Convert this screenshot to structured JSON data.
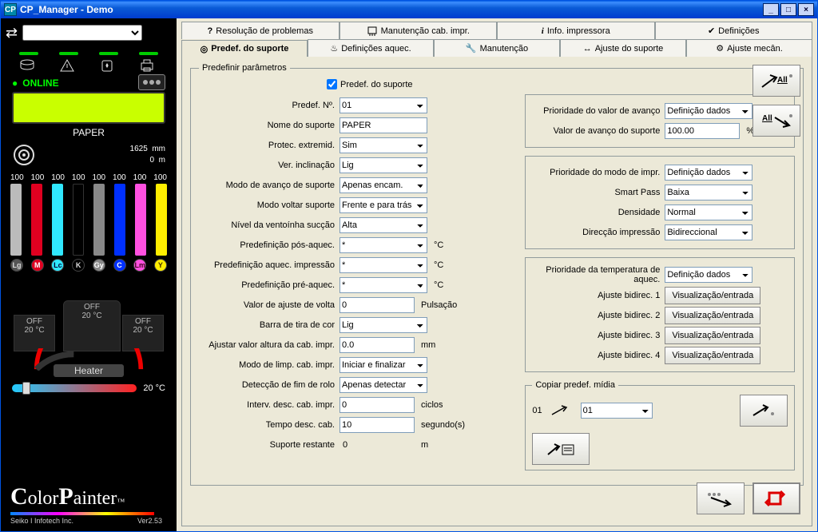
{
  "window": {
    "title": "CP_Manager - Demo"
  },
  "status": {
    "online": "ONLINE",
    "media": "PAPER",
    "length_mm": "1625",
    "length_m": "0",
    "unit_mm": "mm",
    "unit_m": "m",
    "ink_pcts": [
      "100",
      "100",
      "100",
      "100",
      "100",
      "100",
      "100",
      "100"
    ],
    "ink_labels": [
      "Lg",
      "M",
      "Lc",
      "K",
      "Gy",
      "C",
      "Lm",
      "Y"
    ],
    "heater_left_state": "OFF",
    "heater_left_temp": "20 °C",
    "heater_center_state": "OFF",
    "heater_center_temp": "20 °C",
    "heater_right_state": "OFF",
    "heater_right_temp": "20 °C",
    "heater_label": "Heater",
    "slider_temp": "20 °C",
    "logo_company": "Seiko I Infotech Inc.",
    "logo_version": "Ver2.53"
  },
  "tabs": {
    "row1": {
      "troubleshoot": "Resolução de problemas",
      "head_maint": "Manutenção cab. impr.",
      "printer_info": "Info. impressora",
      "settings": "Definições"
    },
    "row2": {
      "media_preset": "Predef. do suporte",
      "heater_set": "Definições aquec.",
      "maintenance": "Manutenção",
      "media_adjust": "Ajuste do suporte",
      "mech_adjust": "Ajuste mecân."
    }
  },
  "panel": {
    "fieldset_title": "Predefinir parâmetros",
    "chk_label": "Predef. do suporte",
    "labels": {
      "preset_no": "Predef. Nº.",
      "media_name": "Nome do suporte",
      "edge_guard": "Protec. extremid.",
      "skew_check": "Ver. inclinação",
      "feed_mode": "Modo de avanço de suporte",
      "return_mode": "Modo voltar suporte",
      "fan_level": "Nível da ventoínha sucção",
      "post_heat": "Predefinição pós-aquec.",
      "print_heat": "Predefinição aquec. impressão",
      "pre_heat": "Predefinição pré-aquec.",
      "back_adj": "Valor de ajuste de volta",
      "color_strip": "Barra de tira de cor",
      "head_height": "Ajustar valor altura da cab. impr.",
      "clean_mode": "Modo de limp. cab. impr.",
      "roll_end": "Detecção de fim de rolo",
      "rest_interval": "Interv. desc. cab. impr.",
      "rest_time": "Tempo desc. cab.",
      "remaining": "Suporte restante",
      "feed_prio": "Prioridade do valor de avanço",
      "feed_val": "Valor de avanço do suporte",
      "print_prio": "Prioridade do modo de impr.",
      "smart_pass": "Smart Pass",
      "density": "Densidade",
      "direction": "Direcção impressão",
      "heat_prio": "Prioridade da temperatura de aquec.",
      "bidi1": "Ajuste bidirec. 1",
      "bidi2": "Ajuste bidirec. 2",
      "bidi3": "Ajuste bidirec. 3",
      "bidi4": "Ajuste bidirec. 4",
      "copy_title": "Copiar predef. mídia",
      "copy_no": "01"
    },
    "values": {
      "preset_no": "01",
      "media_name": "PAPER",
      "edge_guard": "Sim",
      "skew_check": "Lig",
      "feed_mode": "Apenas encam.",
      "return_mode": "Frente e para trás",
      "fan_level": "Alta",
      "post_heat": "*",
      "print_heat": "*",
      "pre_heat": "*",
      "back_adj": "0",
      "color_strip": "Lig",
      "head_height": "0.0",
      "clean_mode": "Iniciar e finalizar",
      "roll_end": "Apenas detectar",
      "rest_interval": "0",
      "rest_time": "10",
      "remaining": "0",
      "feed_prio": "Definição dados",
      "feed_val": "100.00",
      "print_prio": "Definição dados",
      "smart_pass": "Baixa",
      "density": "Normal",
      "direction": "Bidireccional",
      "heat_prio": "Definição dados",
      "bidi_btn": "Visualização/entrada",
      "copy_sel": "01"
    },
    "units": {
      "degC": "°C",
      "pulse": "Pulsação",
      "mm": "mm",
      "cycles": "ciclos",
      "sec": "segundo(s)",
      "m": "m",
      "pct": "%"
    }
  }
}
